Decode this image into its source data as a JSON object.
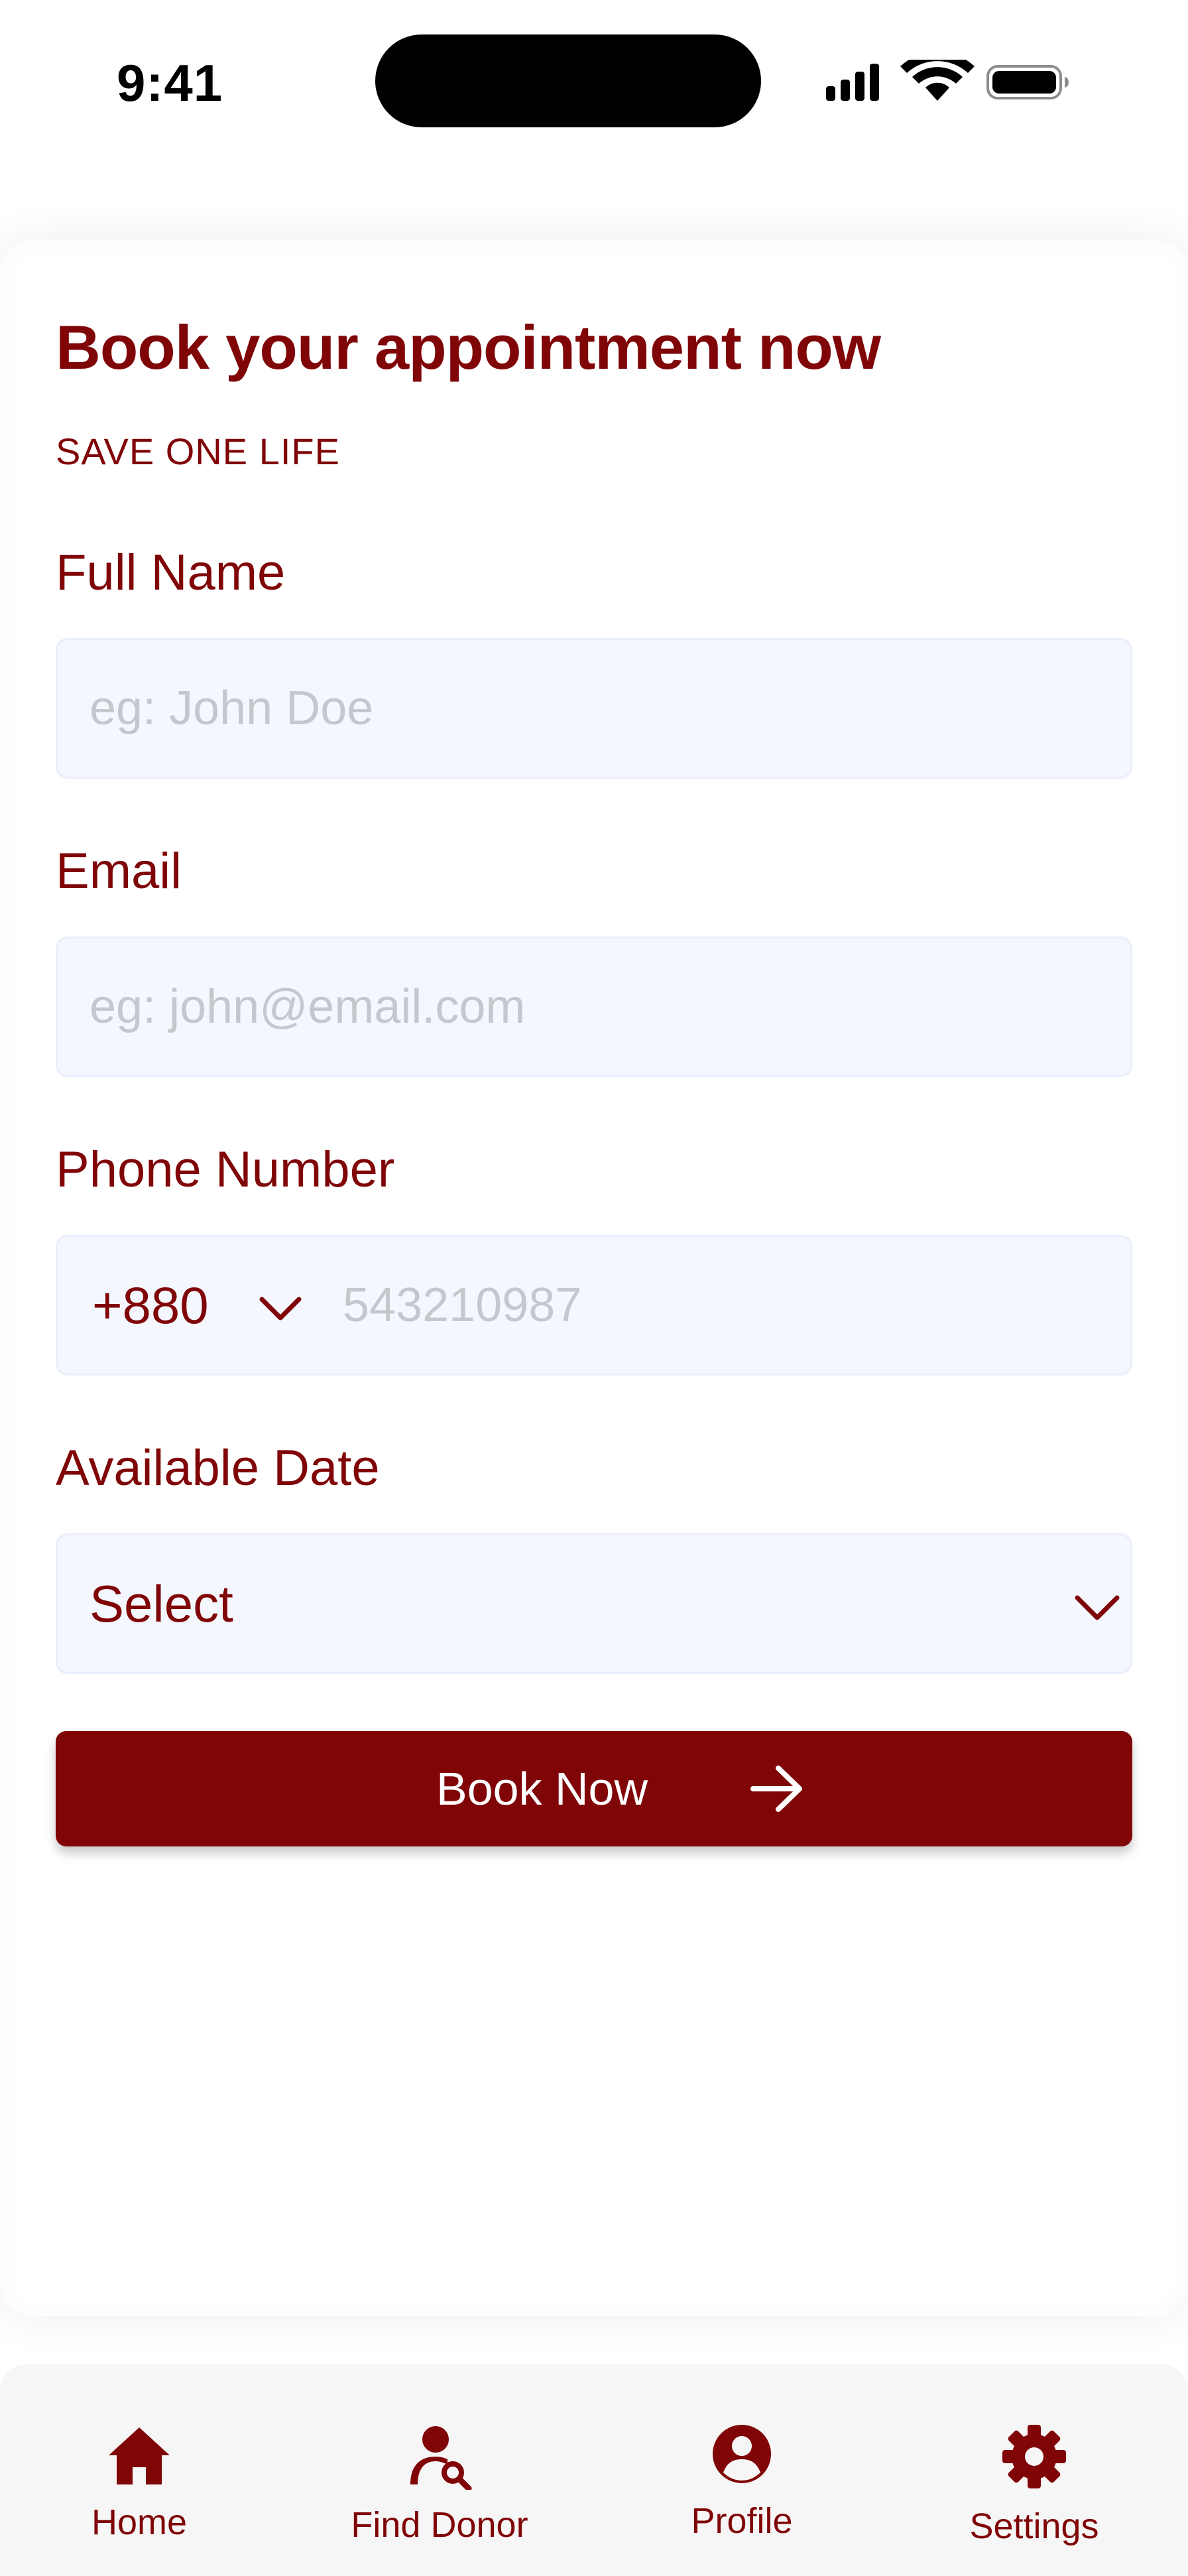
{
  "status_bar": {
    "time": "9:41"
  },
  "header": {
    "title": "Book your appointment now",
    "subtitle": "SAVE ONE LIFE"
  },
  "form": {
    "full_name": {
      "label": "Full Name",
      "placeholder": "eg: John Doe",
      "value": ""
    },
    "email": {
      "label": "Email",
      "placeholder": "eg: john@email.com",
      "value": ""
    },
    "phone": {
      "label": "Phone Number",
      "country_code": "+880",
      "placeholder": "543210987",
      "value": ""
    },
    "date": {
      "label": "Available Date",
      "selected": "Select"
    },
    "submit_label": "Book Now"
  },
  "nav": {
    "items": [
      {
        "label": "Home",
        "icon": "home-icon"
      },
      {
        "label": "Find Donor",
        "icon": "find-donor-icon"
      },
      {
        "label": "Profile",
        "icon": "profile-icon"
      },
      {
        "label": "Settings",
        "icon": "gear-icon"
      }
    ]
  },
  "colors": {
    "primary": "#800507",
    "field_bg": "#f4f7fe",
    "placeholder": "#c5c7cc",
    "nav_bg": "#f7f6f6"
  }
}
